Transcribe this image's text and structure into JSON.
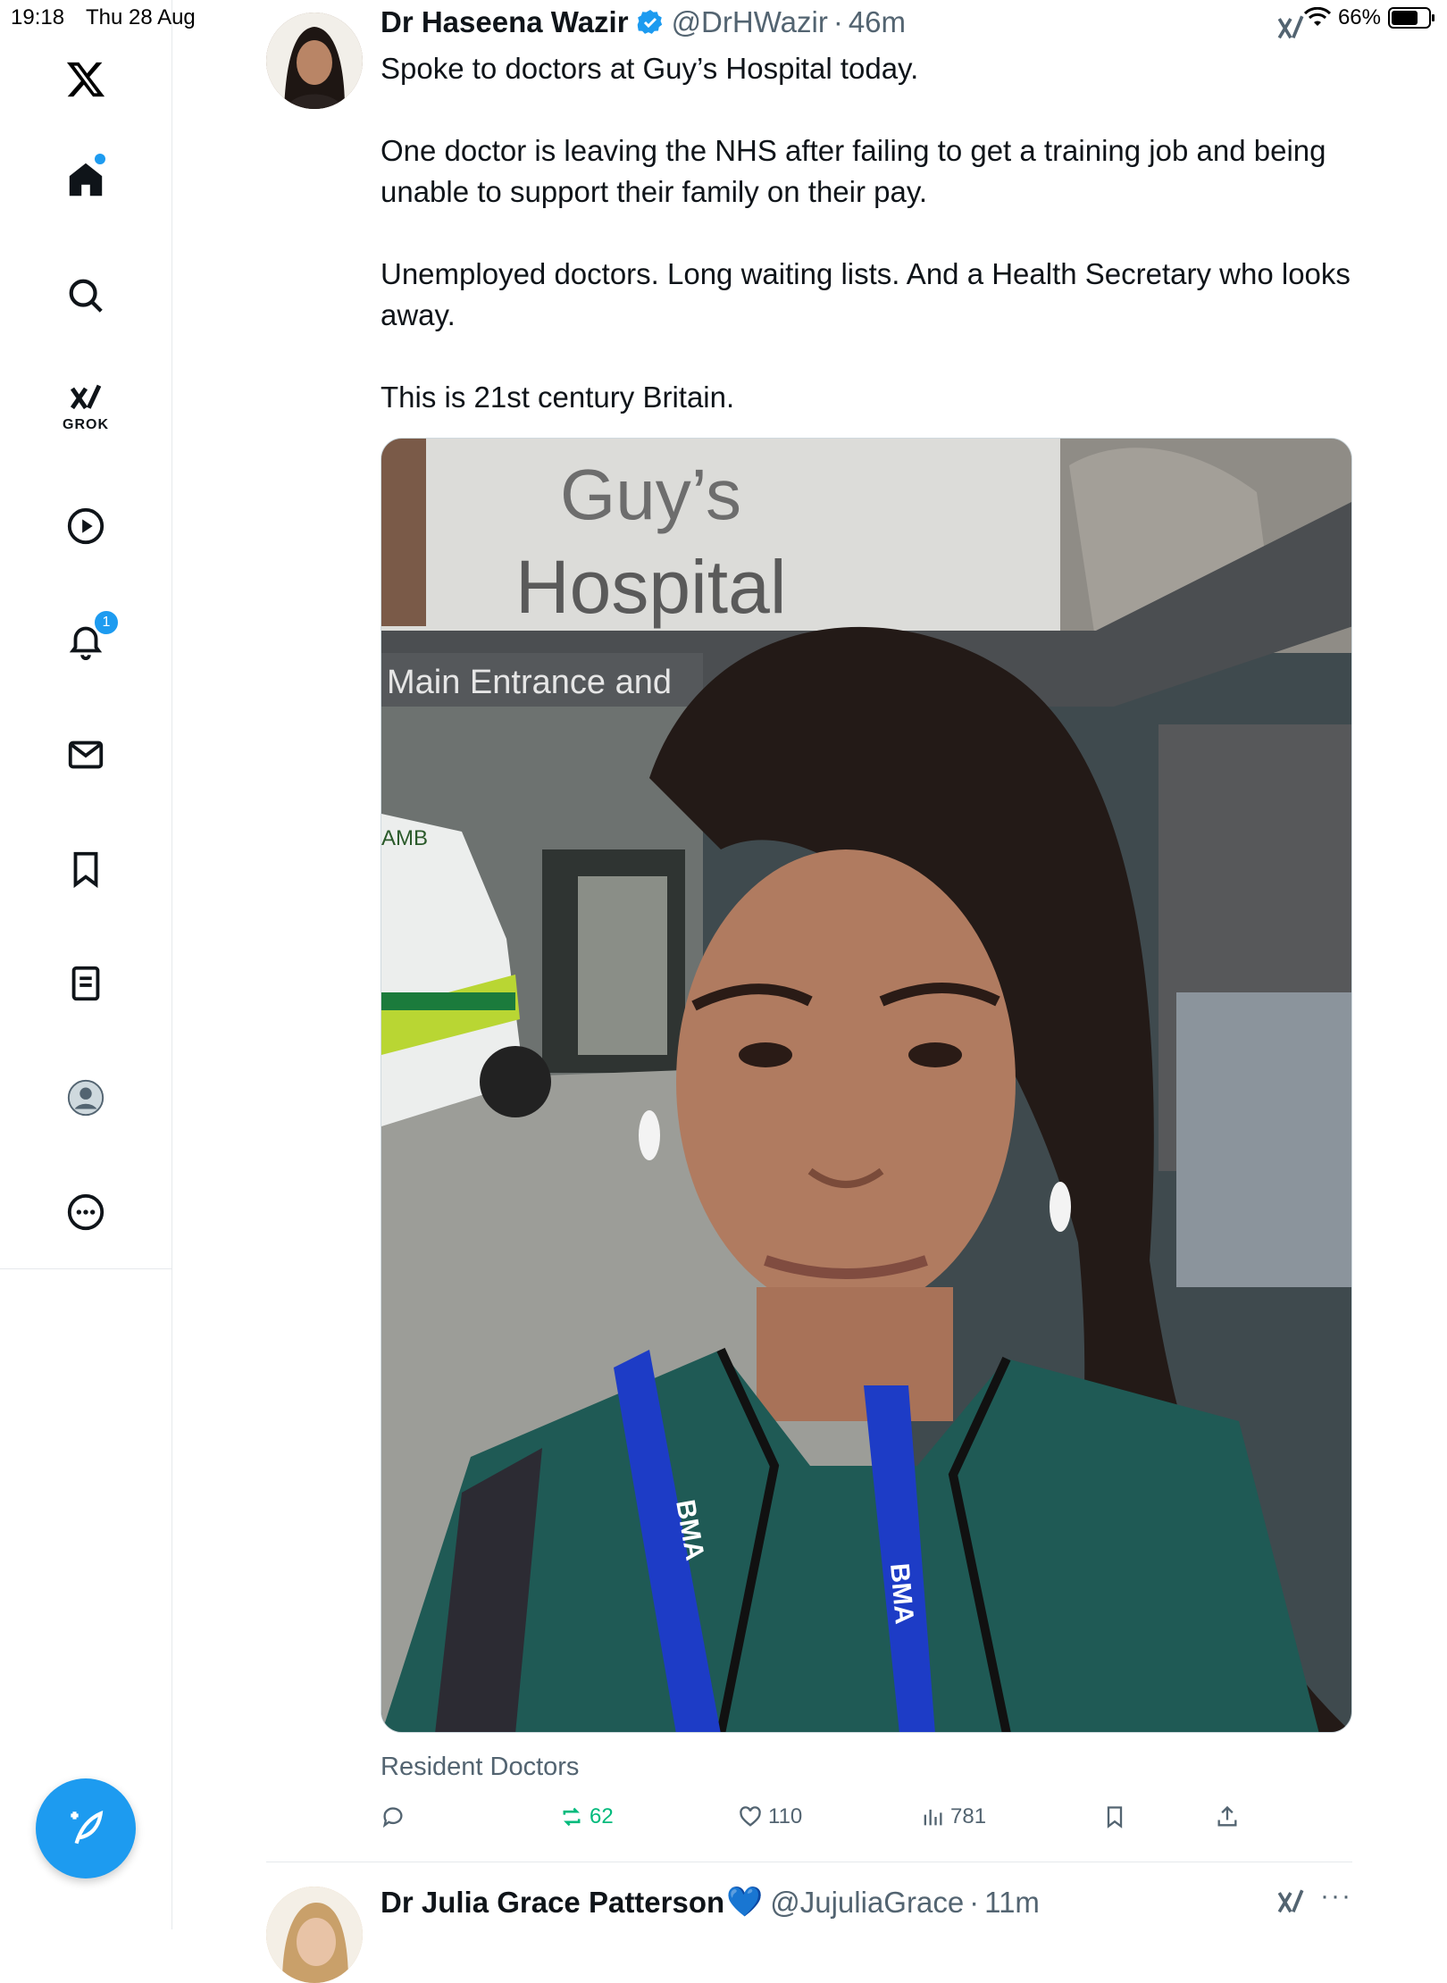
{
  "status_bar": {
    "time": "19:18",
    "date": "Thu 28 Aug",
    "battery": "66%"
  },
  "sidebar": {
    "items": [
      {
        "name": "home",
        "icon": "home-icon"
      },
      {
        "name": "search",
        "icon": "search-icon"
      },
      {
        "name": "grok",
        "icon": "grok-icon",
        "label": "GROK"
      },
      {
        "name": "videos",
        "icon": "play-icon"
      },
      {
        "name": "notifications",
        "icon": "bell-icon",
        "badge": "1"
      },
      {
        "name": "messages",
        "icon": "mail-icon"
      },
      {
        "name": "bookmarks",
        "icon": "bookmark-icon"
      },
      {
        "name": "lists",
        "icon": "list-icon"
      },
      {
        "name": "profile",
        "icon": "profile-icon"
      },
      {
        "name": "more",
        "icon": "more-icon"
      }
    ],
    "compose": {
      "icon": "compose-icon"
    }
  },
  "tweet": {
    "author": "Dr Haseena Wazir",
    "handle": "@DrHWazir",
    "separator": "·",
    "time": "46m",
    "text": "Spoke to doctors at Guy’s Hospital today.\n\nOne doctor is leaving the NHS after failing to get a training job and being unable to support their family on their pay.\n\nUnemployed doctors. Long waiting lists. And a Health Secretary who looks away.\n\nThis is 21st century Britain.",
    "media": {
      "sign_line1": "Guy’s",
      "sign_line2": "Hospital",
      "sign_line3": "Main Entrance and",
      "van_text": "AMB",
      "lanyard_text": "BMA"
    },
    "community": "Resident Doctors",
    "stats": {
      "replies": "",
      "reposts": "62",
      "likes": "110",
      "views": "781"
    },
    "accent": "#1d9bf0",
    "repost_color": "#00ba7c"
  },
  "next_tweet": {
    "author": "Dr Julia Grace Patterson",
    "heart": "💙",
    "handle": "@JujuliaGrace",
    "separator": "·",
    "time": "11m",
    "more": "···"
  }
}
